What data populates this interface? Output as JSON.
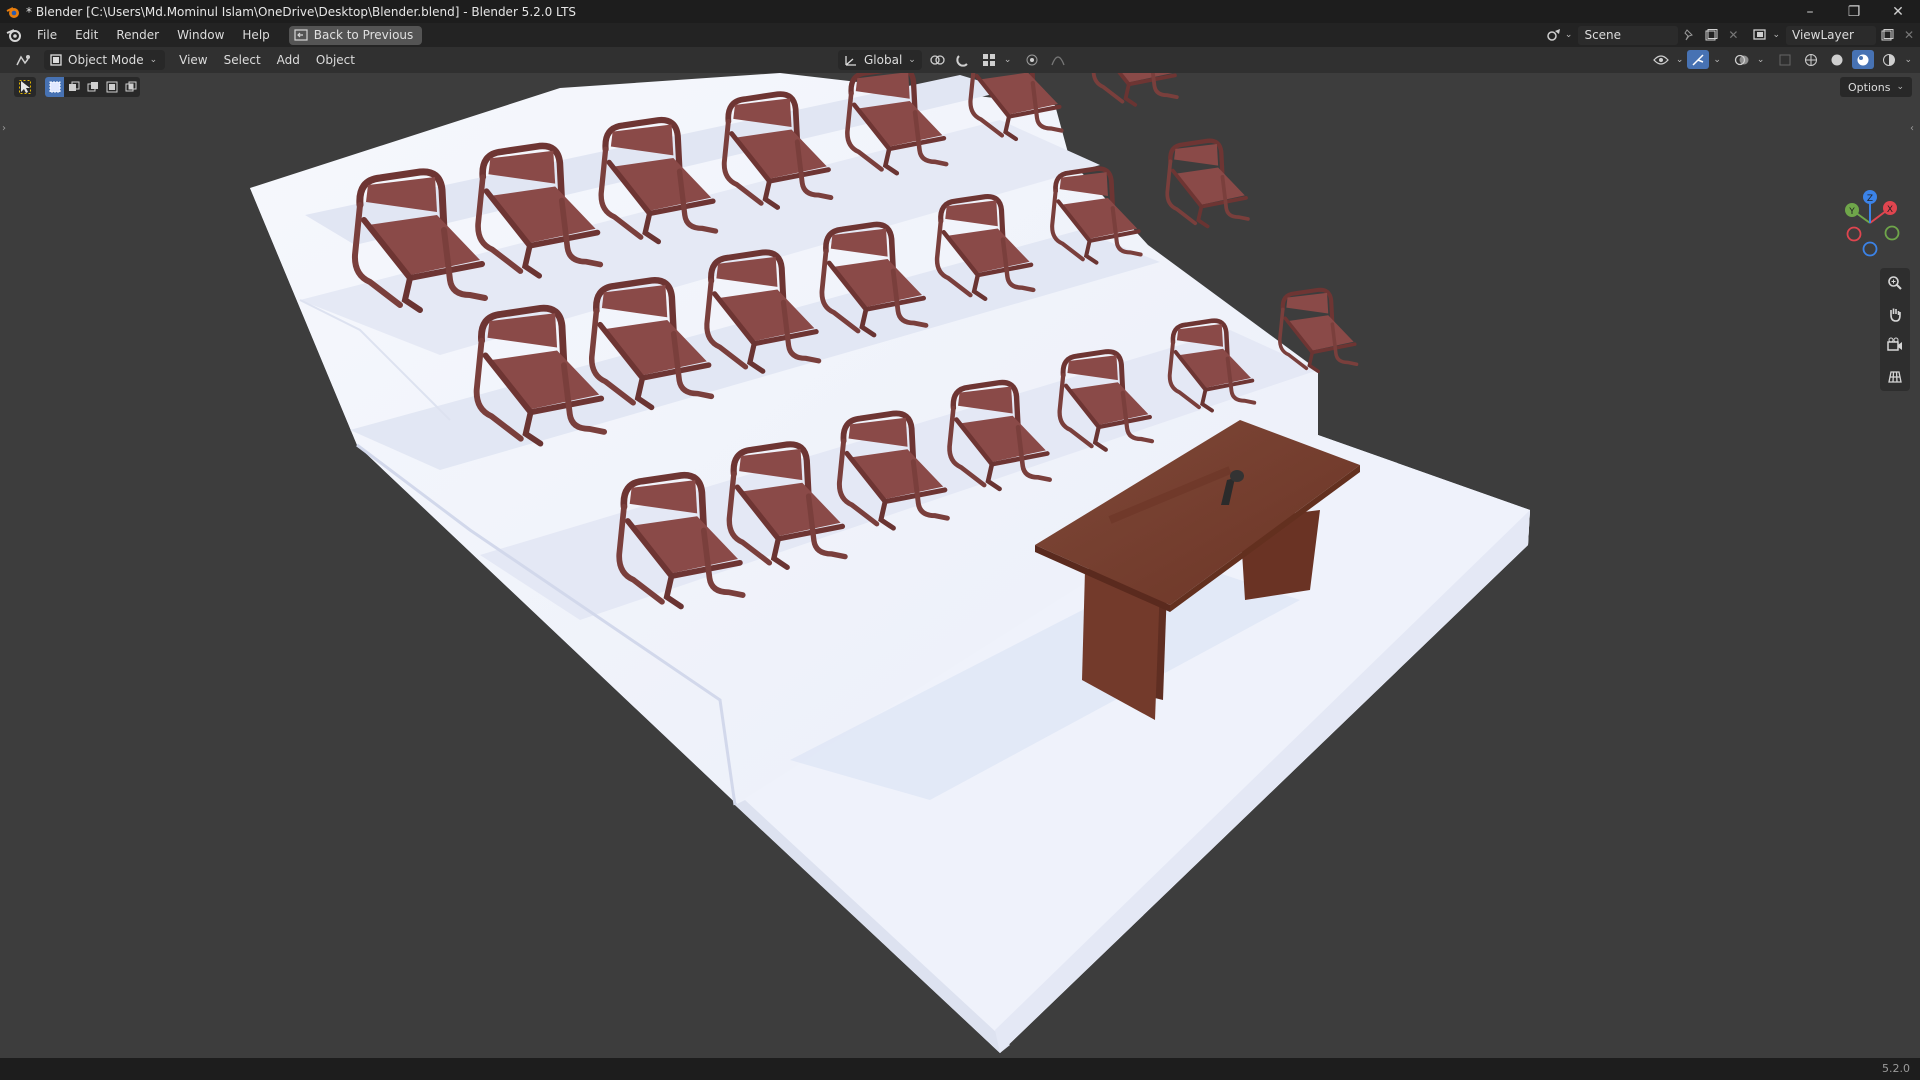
{
  "window": {
    "title": "* Blender [C:\\Users\\Md.Mominul Islam\\OneDrive\\Desktop\\Blender.blend] - Blender 5.2.0 LTS",
    "minimize": "–",
    "restore": "❐",
    "close": "✕"
  },
  "menubar": {
    "items": [
      "File",
      "Edit",
      "Render",
      "Window",
      "Help"
    ],
    "back_button": "Back to Previous",
    "scene_name": "Scene",
    "view_layer": "ViewLayer"
  },
  "viewport_header": {
    "mode": "Object Mode",
    "menus": [
      "View",
      "Select",
      "Add",
      "Object"
    ],
    "transform_orientation": "Global"
  },
  "toolrow": {
    "options_label": "Options"
  },
  "gizmo": {
    "axes": [
      "X",
      "Y",
      "Z"
    ],
    "colors": {
      "x": "#e0454f",
      "y": "#6fa64a",
      "z": "#3b83e8"
    }
  },
  "nav_tools": [
    "zoom-icon",
    "hand-pan-icon",
    "camera-view-icon",
    "orthographic-grid-icon"
  ],
  "scene": {
    "objects": [
      "Staircase",
      "Chairs",
      "Desk",
      "Microphone"
    ],
    "colors": {
      "stair": "#eef1fa",
      "chair": "#8a4a48",
      "desk": "#7a3a2c",
      "background": "#3d3d3d"
    }
  },
  "statusbar": {
    "version": "5.2.0"
  }
}
